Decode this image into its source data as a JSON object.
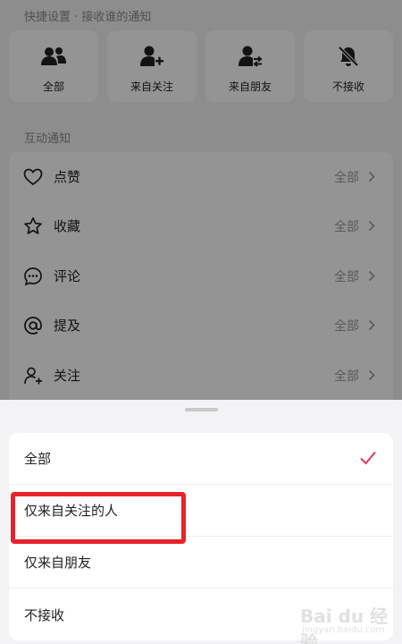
{
  "quick_settings": {
    "title": "快捷设置 · 接收谁的通知",
    "options": [
      {
        "label": "全部",
        "icon": "group-icon"
      },
      {
        "label": "来自关注",
        "icon": "user-plus-icon"
      },
      {
        "label": "来自朋友",
        "icon": "user-swap-icon"
      },
      {
        "label": "不接收",
        "icon": "bell-off-icon"
      }
    ]
  },
  "interaction": {
    "title": "互动通知",
    "rows": [
      {
        "label": "点赞",
        "value": "全部",
        "icon": "heart-icon"
      },
      {
        "label": "收藏",
        "value": "全部",
        "icon": "star-icon"
      },
      {
        "label": "评论",
        "value": "全部",
        "icon": "comment-icon"
      },
      {
        "label": "提及",
        "value": "全部",
        "icon": "at-icon"
      },
      {
        "label": "关注",
        "value": "全部",
        "icon": "user-add-icon"
      }
    ]
  },
  "sheet": {
    "options": [
      {
        "label": "全部",
        "selected": true
      },
      {
        "label": "仅来自关注的人",
        "selected": false
      },
      {
        "label": "仅来自朋友",
        "selected": false
      },
      {
        "label": "不接收",
        "selected": false
      }
    ],
    "check_color": "#e8375a",
    "highlight_color": "#e8232a"
  },
  "watermark": {
    "main": "Bai du 经验",
    "sub": "jingyan.baidu.com"
  }
}
